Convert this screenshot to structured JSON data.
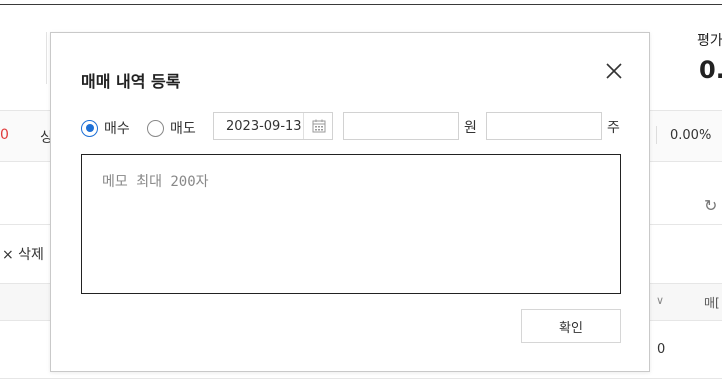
{
  "background": {
    "eval_label": "평가",
    "eval_value": "0.(",
    "band_left_red": "0",
    "band_left_text": "싱",
    "band_pct": "0.00%",
    "refresh_icon": "refresh-icon",
    "delete_label": "× 삭제",
    "column_chevron": "chevron-down-icon",
    "column_label": "매[",
    "row_value": "0"
  },
  "modal": {
    "title": "매매 내역 등록",
    "close_icon": "close-icon",
    "radio_buy_label": "매수",
    "radio_sell_label": "매도",
    "selected": "매수",
    "date_value": "2023-09-13",
    "calendar_icon": "calendar-icon",
    "price_value": "",
    "price_unit": "원",
    "qty_value": "",
    "qty_unit": "주",
    "memo_placeholder": "메모 최대 200자",
    "memo_value": "",
    "confirm_label": "확인"
  },
  "colors": {
    "accent": "#1e70d6",
    "negative": "#e03b3b"
  }
}
